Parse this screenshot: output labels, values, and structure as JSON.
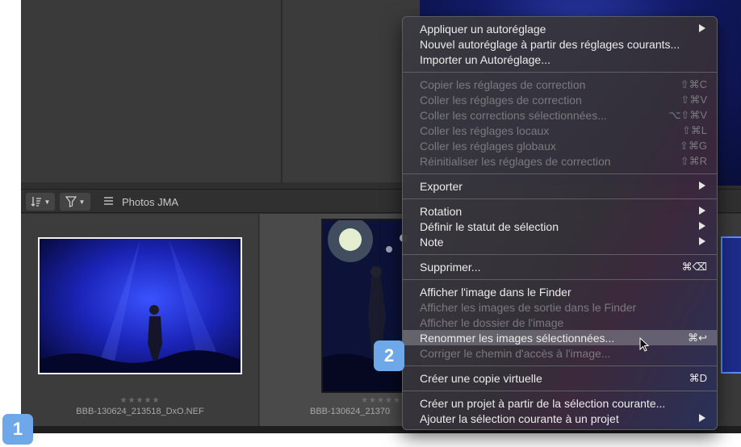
{
  "toolbar": {
    "sort_icon": "sort-icon",
    "filter_icon": "filter-icon",
    "folder_icon": "folder-icon",
    "folder_label": "Photos JMA"
  },
  "thumbnails": [
    {
      "stars": "★★★★★",
      "filename": "BBB-130624_213518_DxO.NEF"
    },
    {
      "stars": "★★★★★",
      "filename": "BBB-130624_21370"
    }
  ],
  "menu": {
    "items": [
      {
        "label": "Appliquer un autoréglage",
        "submenu": true
      },
      {
        "label": "Nouvel autoréglage à partir des réglages courants..."
      },
      {
        "label": "Importer un Autoréglage..."
      },
      {
        "label": "Copier les réglages de correction",
        "shortcut": "⇧⌘C",
        "disabled": true
      },
      {
        "label": "Coller les réglages de correction",
        "shortcut": "⇧⌘V",
        "disabled": true
      },
      {
        "label": "Coller les corrections sélectionnées...",
        "shortcut": "⌥⇧⌘V",
        "disabled": true
      },
      {
        "label": "Coller les réglages locaux",
        "shortcut": "⇧⌘L",
        "disabled": true
      },
      {
        "label": "Coller les réglages globaux",
        "shortcut": "⇧⌘G",
        "disabled": true
      },
      {
        "label": "Réinitialiser les réglages de correction",
        "shortcut": "⇧⌘R",
        "disabled": true
      },
      {
        "label": "Exporter",
        "submenu": true
      },
      {
        "label": "Rotation",
        "submenu": true
      },
      {
        "label": "Définir le statut de sélection",
        "submenu": true
      },
      {
        "label": "Note",
        "submenu": true
      },
      {
        "label": "Supprimer...",
        "shortcut": "⌘⌫"
      },
      {
        "label": "Afficher l'image dans le Finder"
      },
      {
        "label": "Afficher les images de sortie dans le Finder",
        "disabled": true
      },
      {
        "label": "Afficher le dossier de l'image",
        "disabled": true
      },
      {
        "label": "Renommer les images sélectionnées...",
        "shortcut": "⌘↩",
        "highlighted": true
      },
      {
        "label": "Corriger le chemin d'accès à l'image...",
        "disabled": true
      },
      {
        "label": "Créer une copie virtuelle",
        "shortcut": "⌘D"
      },
      {
        "label": "Créer un projet à partir de la sélection courante..."
      },
      {
        "label": "Ajouter la sélection courante à un projet",
        "submenu": true
      }
    ]
  },
  "badges": {
    "one": "1",
    "two": "2"
  },
  "colors": {
    "badge": "#6ea8e8",
    "menu_bg": "#3a3a40",
    "highlight": "#8c8c96"
  }
}
